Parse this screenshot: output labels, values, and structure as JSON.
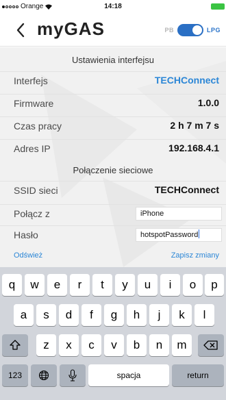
{
  "status_bar": {
    "carrier": "Orange",
    "time": "14:18"
  },
  "nav": {
    "logo_text": "myGAS",
    "toggle_left": "PB",
    "toggle_right": "LPG"
  },
  "interface_section": {
    "title": "Ustawienia interfejsu",
    "rows": [
      {
        "label": "Interfejs",
        "value": "TECHConnect"
      },
      {
        "label": "Firmware",
        "value": "1.0.0"
      },
      {
        "label": "Czas pracy",
        "value": "2 h 7 m 7 s"
      },
      {
        "label": "Adres IP",
        "value": "192.168.4.1"
      }
    ]
  },
  "network_section": {
    "title": "Połączenie sieciowe",
    "ssid_label": "SSID sieci",
    "ssid_value": "TECHConnect",
    "connect_label": "Połącz z",
    "connect_value": "iPhone",
    "password_label": "Hasło",
    "password_value": "hotspotPassword"
  },
  "actions": {
    "refresh": "Odśwież",
    "save": "Zapisz zmiany"
  },
  "keyboard": {
    "row1": [
      "q",
      "w",
      "e",
      "r",
      "t",
      "y",
      "u",
      "i",
      "o",
      "p"
    ],
    "row2": [
      "a",
      "s",
      "d",
      "f",
      "g",
      "h",
      "j",
      "k",
      "l"
    ],
    "row3": [
      "z",
      "x",
      "c",
      "v",
      "b",
      "n",
      "m"
    ],
    "numbers": "123",
    "space": "spacja",
    "return": "return"
  },
  "colors": {
    "accent": "#2b86d6",
    "toggle": "#2a6fc4",
    "battery": "#3ac442"
  }
}
